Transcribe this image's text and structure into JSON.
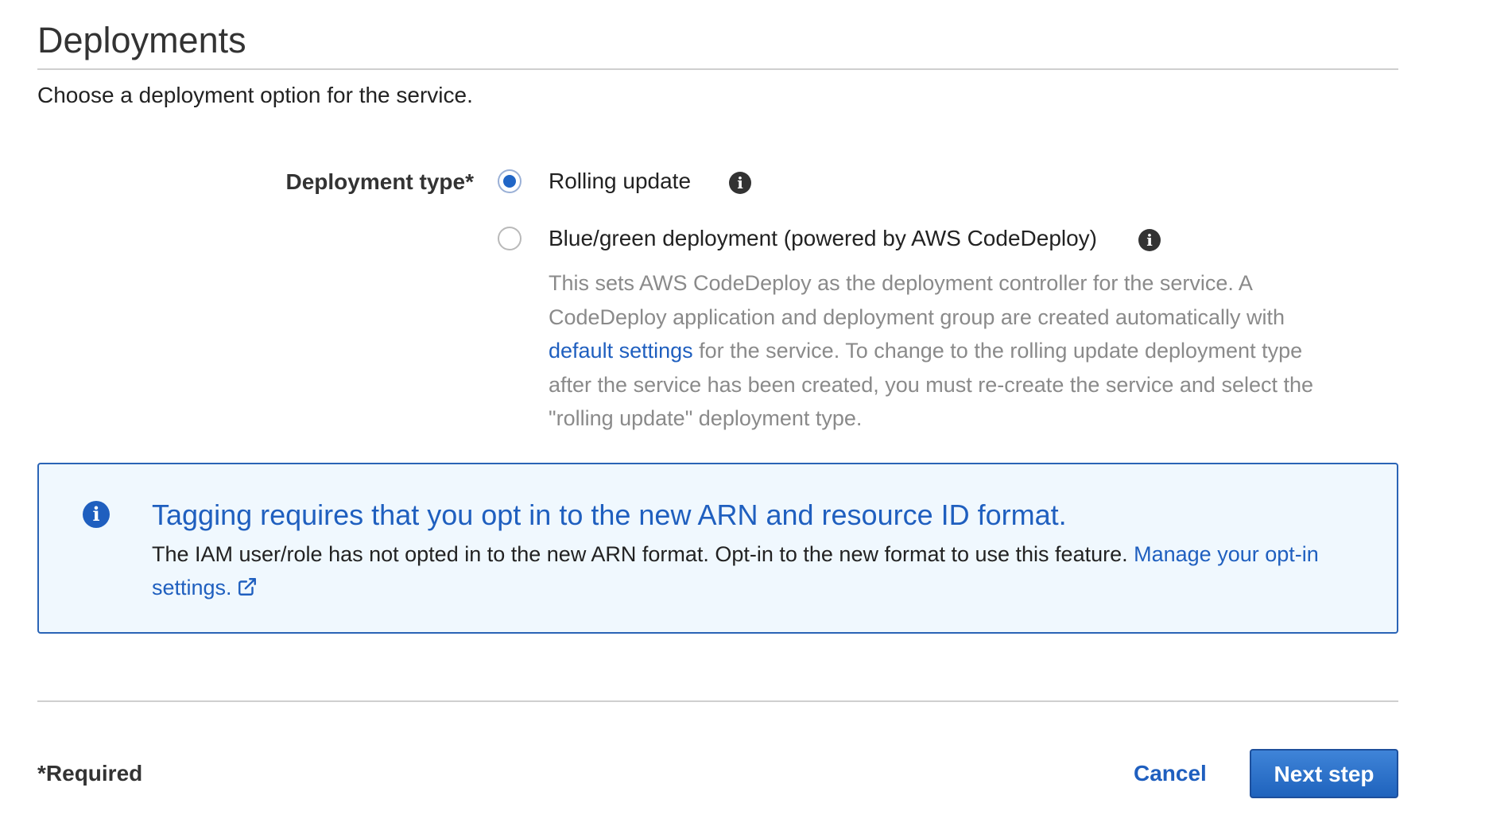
{
  "section": {
    "title": "Deployments",
    "subtitle": "Choose a deployment option for the service."
  },
  "deployment_type": {
    "label": "Deployment type*",
    "options": [
      {
        "label": "Rolling update",
        "selected": true,
        "info_icon": "info-icon"
      },
      {
        "label": "Blue/green deployment (powered by AWS CodeDeploy)",
        "selected": false,
        "info_icon": "info-icon"
      }
    ],
    "description": {
      "part1": "This sets AWS CodeDeploy as the deployment controller for the service. A CodeDeploy application and deployment group are created automatically with ",
      "link": "default settings",
      "part2": " for the service. To change to the rolling update deployment type after the service has been created, you must re-create the service and select the \"rolling update\" deployment type."
    }
  },
  "alert": {
    "icon": "info-icon",
    "title": "Tagging requires that you opt in to the new ARN and resource ID format.",
    "body": "The IAM user/role has not opted in to the new ARN format. Opt-in to the new format to use this feature. ",
    "link": "Manage your opt-in settings.",
    "link_icon": "external-link-icon"
  },
  "footer": {
    "required_note": "*Required",
    "cancel_label": "Cancel",
    "next_label": "Next step"
  },
  "colors": {
    "accent": "#1f5fbf",
    "alert_background": "#f0f8fe",
    "alert_border": "#2a64b6",
    "muted_text": "#8a8a8a"
  }
}
